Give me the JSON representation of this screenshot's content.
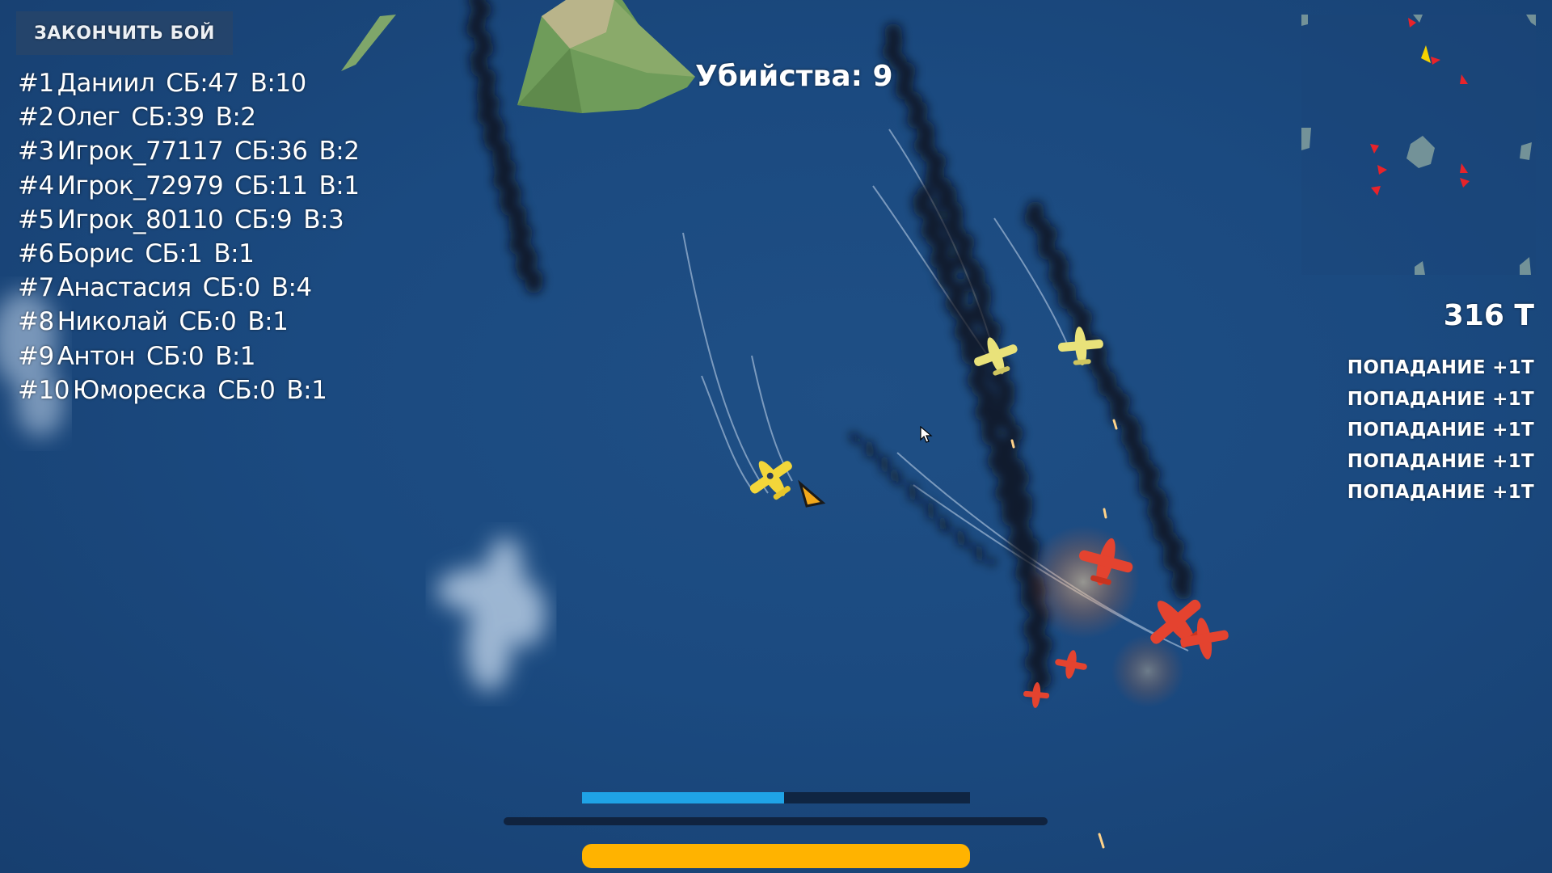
{
  "end_battle": {
    "label": "ЗАКОНЧИТЬ БОЙ"
  },
  "leaderboard": [
    {
      "rank": "#1",
      "name": "Даниил",
      "score": "СБ:47",
      "kills": "В:10"
    },
    {
      "rank": "#2",
      "name": "Олег",
      "score": "СБ:39",
      "kills": "В:2"
    },
    {
      "rank": "#3",
      "name": "Игрок_77117",
      "score": "СБ:36",
      "kills": "В:2"
    },
    {
      "rank": "#4",
      "name": "Игрок_72979",
      "score": "СБ:11",
      "kills": "В:1"
    },
    {
      "rank": "#5",
      "name": "Игрок_80110",
      "score": "СБ:9",
      "kills": "В:3"
    },
    {
      "rank": "#6",
      "name": "Борис",
      "score": "СБ:1",
      "kills": "В:1"
    },
    {
      "rank": "#7",
      "name": "Анастасия",
      "score": "СБ:0",
      "kills": "В:4"
    },
    {
      "rank": "#8",
      "name": "Николай",
      "score": "СБ:0",
      "kills": "В:1"
    },
    {
      "rank": "#9",
      "name": "Антон",
      "score": "СБ:0",
      "kills": "В:1"
    },
    {
      "rank": "#10",
      "name": "Юмореска",
      "score": "СБ:0",
      "kills": "В:1"
    }
  ],
  "kills": {
    "label": "Убийства: 9"
  },
  "tokens": {
    "value": "316 Т"
  },
  "hit_feed": [
    "ПОПАДАНИЕ +1Т",
    "ПОПАДАНИЕ +1Т",
    "ПОПАДАНИЕ +1Т",
    "ПОПАДАНИЕ +1Т",
    "ПОПАДАНИЕ +1Т"
  ],
  "boost": {
    "fraction": 0.52,
    "color": "#1fa3e6"
  },
  "ammo": {
    "fraction": 1.0,
    "color": "#ffb300"
  },
  "colors": {
    "sea": "#1b4a80",
    "player_plane": "#f3d63a",
    "enemy_plane": "#e4432f",
    "ally_plane": "#e9e27a",
    "smoke": "#0a0d14",
    "minimap_enemy": "#e8232a",
    "minimap_player": "#f5d300"
  },
  "icons": [
    "mouse-cursor-icon",
    "player-plane-icon",
    "enemy-plane-icon",
    "direction-arrow-icon",
    "minimap-marker-icon"
  ]
}
